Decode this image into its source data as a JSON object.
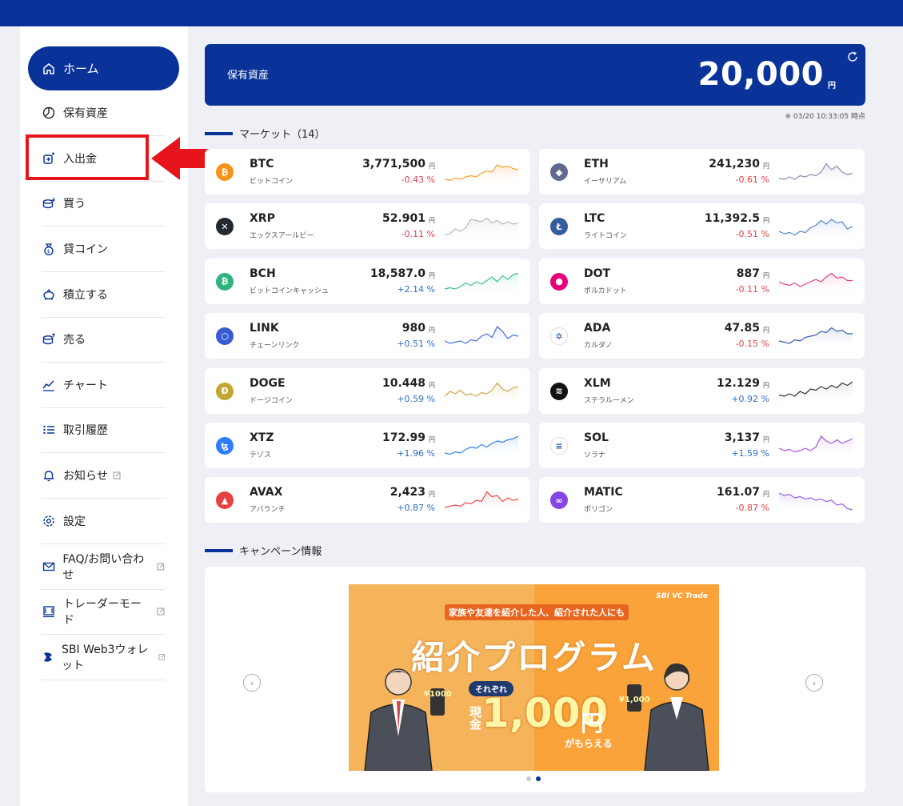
{
  "sidebar": {
    "items": [
      {
        "label": "ホーム",
        "icon": "home-icon"
      },
      {
        "label": "保有資産",
        "icon": "pie-chart-icon"
      },
      {
        "label": "入出金",
        "icon": "deposit-withdraw-icon"
      },
      {
        "label": "買う",
        "icon": "buy-coins-icon"
      },
      {
        "label": "貸コイン",
        "icon": "lending-bag-icon"
      },
      {
        "label": "積立する",
        "icon": "piggy-bank-icon"
      },
      {
        "label": "売る",
        "icon": "sell-coins-icon"
      },
      {
        "label": "チャート",
        "icon": "line-chart-icon"
      },
      {
        "label": "取引履歴",
        "icon": "list-icon"
      },
      {
        "label": "お知らせ",
        "icon": "bell-icon"
      },
      {
        "label": "設定",
        "icon": "gear-icon"
      },
      {
        "label": "FAQ/お問い合わせ",
        "icon": "mail-icon"
      },
      {
        "label": "トレーダーモード",
        "icon": "monitor-icon"
      },
      {
        "label": "SBI Web3ウォレット",
        "icon": "wallet-logo-icon"
      }
    ]
  },
  "holdings": {
    "label": "保有資産",
    "value": "20,000",
    "unit": "円",
    "timestamp": "※ 03/20 10:33:05 時点"
  },
  "market": {
    "title": "マーケット（14）",
    "yen": "円",
    "coins": [
      {
        "symbol": "BTC",
        "name": "ビットコイン",
        "price": "3,771,500",
        "change": "-0.43 %",
        "dir": "neg",
        "color": "#f7931a",
        "glyph": "₿",
        "line": "#f7a23a",
        "fill": "#fde7cc",
        "spark": [
          0.2,
          0.15,
          0.25,
          0.2,
          0.3,
          0.35,
          0.3,
          0.45,
          0.55,
          0.5,
          0.8,
          0.7,
          0.75,
          0.65,
          0.6
        ]
      },
      {
        "symbol": "ETH",
        "name": "イーサリアム",
        "price": "241,230",
        "change": "-0.61 %",
        "dir": "neg",
        "color": "#62688f",
        "glyph": "◆",
        "line": "#8a8fb0",
        "fill": "#e6e7f0",
        "spark": [
          0.25,
          0.2,
          0.3,
          0.2,
          0.35,
          0.3,
          0.4,
          0.35,
          0.5,
          0.85,
          0.6,
          0.75,
          0.5,
          0.4,
          0.45
        ]
      },
      {
        "symbol": "XRP",
        "name": "エックスアールピー",
        "price": "52.901",
        "change": "-0.11 %",
        "dir": "neg",
        "color": "#23292f",
        "glyph": "✕",
        "line": "#b9b9b9",
        "fill": "#eeeeee",
        "spark": [
          0.15,
          0.2,
          0.4,
          0.3,
          0.45,
          0.8,
          0.75,
          0.7,
          0.85,
          0.65,
          0.75,
          0.6,
          0.7,
          0.6,
          0.65
        ]
      },
      {
        "symbol": "LTC",
        "name": "ライトコイン",
        "price": "11,392.5",
        "change": "-0.51 %",
        "dir": "neg",
        "color": "#345d9d",
        "glyph": "Ł",
        "line": "#5a86c8",
        "fill": "#dde7f6",
        "spark": [
          0.3,
          0.2,
          0.25,
          0.15,
          0.3,
          0.25,
          0.45,
          0.55,
          0.75,
          0.6,
          0.8,
          0.65,
          0.7,
          0.4,
          0.5
        ]
      },
      {
        "symbol": "BCH",
        "name": "ビットコインキャッシュ",
        "price": "18,587.0",
        "change": "+2.14 %",
        "dir": "pos",
        "color": "#2fb37f",
        "glyph": "₿",
        "line": "#3cc08a",
        "fill": "#d9f3e8",
        "spark": [
          0.2,
          0.25,
          0.2,
          0.3,
          0.45,
          0.35,
          0.5,
          0.4,
          0.55,
          0.7,
          0.5,
          0.75,
          0.6,
          0.8,
          0.85
        ]
      },
      {
        "symbol": "DOT",
        "name": "ポルカドット",
        "price": "887",
        "change": "-0.11 %",
        "dir": "neg",
        "color": "#e6007a",
        "glyph": "●",
        "line": "#e0408a",
        "fill": "#fbdfeb",
        "spark": [
          0.5,
          0.4,
          0.35,
          0.45,
          0.3,
          0.4,
          0.5,
          0.6,
          0.5,
          0.7,
          0.85,
          0.65,
          0.7,
          0.55,
          0.55
        ]
      },
      {
        "symbol": "LINK",
        "name": "チェーンリンク",
        "price": "980",
        "change": "+0.51 %",
        "dir": "pos",
        "color": "#375bd2",
        "glyph": "⬡",
        "line": "#4a6fd8",
        "fill": "#dfe6fa",
        "spark": [
          0.3,
          0.2,
          0.25,
          0.3,
          0.2,
          0.35,
          0.3,
          0.5,
          0.6,
          0.45,
          0.9,
          0.7,
          0.4,
          0.55,
          0.5
        ]
      },
      {
        "symbol": "ADA",
        "name": "カルダノ",
        "price": "47.85",
        "change": "-0.15 %",
        "dir": "neg",
        "color": "#ffffff",
        "glyph": "✲",
        "line": "#3a5fa8",
        "fill": "#dde4f3",
        "spark": [
          0.3,
          0.25,
          0.2,
          0.35,
          0.3,
          0.45,
          0.5,
          0.55,
          0.7,
          0.65,
          0.85,
          0.7,
          0.75,
          0.6,
          0.6
        ]
      },
      {
        "symbol": "DOGE",
        "name": "ドージコイン",
        "price": "10.448",
        "change": "+0.59 %",
        "dir": "pos",
        "color": "#c2a633",
        "glyph": "Ð",
        "line": "#c9a84e",
        "fill": "#f4ecd2",
        "spark": [
          0.3,
          0.5,
          0.4,
          0.55,
          0.35,
          0.4,
          0.3,
          0.45,
          0.4,
          0.55,
          0.85,
          0.6,
          0.5,
          0.65,
          0.7
        ]
      },
      {
        "symbol": "XLM",
        "name": "ステラルーメン",
        "price": "12.129",
        "change": "+0.92 %",
        "dir": "pos",
        "color": "#111111",
        "glyph": "≋",
        "line": "#333333",
        "fill": "#e5e5e5",
        "spark": [
          0.35,
          0.3,
          0.4,
          0.3,
          0.5,
          0.4,
          0.6,
          0.55,
          0.7,
          0.6,
          0.75,
          0.65,
          0.85,
          0.75,
          0.9
        ]
      },
      {
        "symbol": "XTZ",
        "name": "テゾス",
        "price": "172.99",
        "change": "+1.96 %",
        "dir": "pos",
        "color": "#2c7df7",
        "glyph": "ꜩ",
        "line": "#2f7fe0",
        "fill": "#dbe8fb",
        "spark": [
          0.2,
          0.15,
          0.25,
          0.2,
          0.35,
          0.45,
          0.4,
          0.55,
          0.45,
          0.6,
          0.7,
          0.65,
          0.75,
          0.8,
          0.9
        ]
      },
      {
        "symbol": "SOL",
        "name": "ソラナ",
        "price": "3,137",
        "change": "+1.59 %",
        "dir": "pos",
        "color": "#ffffff",
        "glyph": "≡",
        "line": "#a855e0",
        "fill": "#efe0fa",
        "spark": [
          0.4,
          0.3,
          0.35,
          0.25,
          0.3,
          0.4,
          0.3,
          0.45,
          0.9,
          0.7,
          0.6,
          0.75,
          0.6,
          0.7,
          0.8
        ]
      },
      {
        "symbol": "AVAX",
        "name": "アバランチ",
        "price": "2,423",
        "change": "+0.87 %",
        "dir": "pos",
        "color": "#e84142",
        "glyph": "▲",
        "line": "#e84a4a",
        "fill": "#fbdcdc",
        "spark": [
          0.2,
          0.25,
          0.3,
          0.25,
          0.4,
          0.35,
          0.5,
          0.45,
          0.85,
          0.65,
          0.7,
          0.45,
          0.6,
          0.5,
          0.55
        ]
      },
      {
        "symbol": "MATIC",
        "name": "ポリゴン",
        "price": "161.07",
        "change": "-0.87 %",
        "dir": "neg",
        "color": "#8247e5",
        "glyph": "∞",
        "line": "#9a5fe8",
        "fill": "#ece2fb",
        "spark": [
          0.8,
          0.7,
          0.75,
          0.6,
          0.65,
          0.55,
          0.6,
          0.5,
          0.55,
          0.45,
          0.5,
          0.3,
          0.35,
          0.15,
          0.1
        ]
      }
    ]
  },
  "campaign": {
    "title": "キャンペーン情報",
    "banner": {
      "pill": "家族や友達を紹介した人、紹介された人にも",
      "logo": "SBI VC Trade",
      "title": "紹介プログラム",
      "each": "それぞれ",
      "cash": "現金",
      "amount": "1,000",
      "yen": "円",
      "get": "がもらえる",
      "phone_left": "¥1000",
      "phone_right": "¥1,000"
    },
    "slides_total": 2,
    "active_slide": 2
  }
}
